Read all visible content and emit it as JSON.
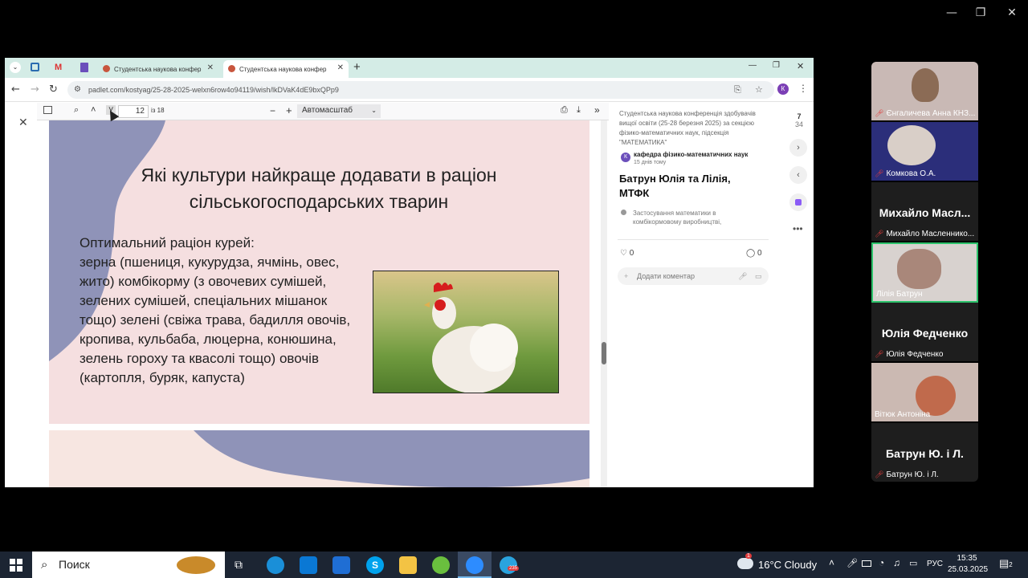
{
  "window_controls": {
    "minimize": "—",
    "restore": "❐",
    "close": "✕"
  },
  "browser": {
    "tabs": [
      {
        "label": "Студентська наукова конфер"
      },
      {
        "label": "Студентська наукова конфер"
      }
    ],
    "new_tab": "+",
    "url": "padlet.com/kostyag/25-28-2025-welxn6row4o94119/wish/lkDVaK4dE9bxQPp9",
    "profile_initial": "К"
  },
  "pdf_toolbar": {
    "page_value": "12",
    "page_total": "із 18",
    "zoom_label": "Автомасштаб"
  },
  "slide": {
    "title_line1": "Які культури найкраще додавати в раціон",
    "title_line2": "сільськогосподарських тварин",
    "body": [
      "Оптимальний раціон курей:",
      "зерна (пшениця, кукурудза, ячмінь, овес,",
      "жито) комбікорму (з овочевих сумішей,",
      "зелених сумішей, спеціальних мішанок",
      "тощо) зелені (свіжа трава, бадилля овочів,",
      "кропива, кульбаба, люцерна, конюшина,",
      "зелень гороху та квасолі тощо) овочів",
      "(картопля, буряк, капуста)"
    ]
  },
  "side": {
    "header": "Студентська наукова конференція здобувачів вищої освіти (25-28 березня 2025) за секцією фізико-математичних наук, підсекція \"МАТЕМАТИКА\"",
    "author": "кафедра фізико-математичних наук",
    "author_initial": "К",
    "time": "15 днів тому",
    "post_title": "Батрун Юлія та Лілія, МТФК",
    "section": "Застосування математики в комбікормовому виробництві,",
    "likes": "0",
    "comments": "0",
    "comment_placeholder": "Додати коментар",
    "counter_current": "7",
    "counter_total": "34"
  },
  "zoom_participants": [
    {
      "name": "Єнгаличева Анна КНЗ..."
    },
    {
      "name": "Комкова О.А."
    },
    {
      "name": "Михайло Масленнико...",
      "big": "Михайло Масл..."
    },
    {
      "name": "Лілія Батрун"
    },
    {
      "name": "Юлія Федченко",
      "big": "Юлія Федченко"
    },
    {
      "name": "Вітюк Антоніна"
    },
    {
      "name": "Батрун Ю. і Л.",
      "big": "Батрун Ю. і Л."
    }
  ],
  "taskbar": {
    "search": "Поиск",
    "weather": "16°C Cloudy",
    "lang": "РУС",
    "time": "15:35",
    "date": "25.03.2025",
    "notif_count": "2",
    "telegram_badge": "235",
    "mail_badge": "1"
  },
  "colors": {
    "accent": "#2cc36b",
    "slide_bg": "#f5dfe0",
    "blob": "#8f93b8",
    "taskbar": "#1c2533"
  }
}
